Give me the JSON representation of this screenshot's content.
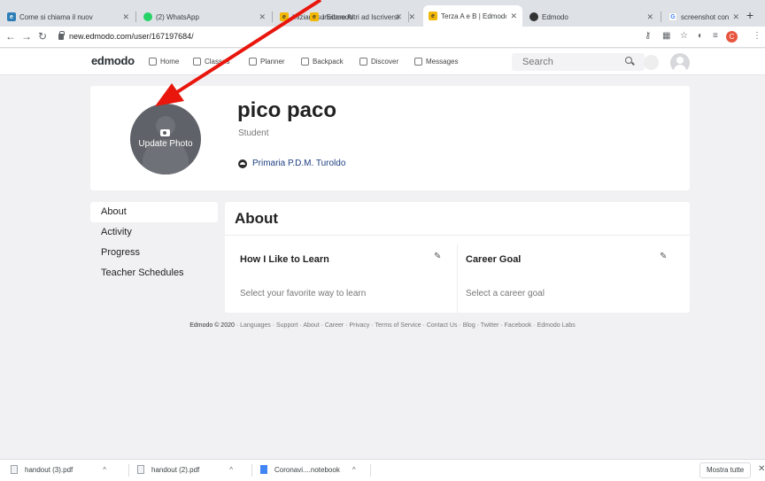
{
  "browser": {
    "tabs": [
      {
        "title": "Come si chiama il nuov",
        "fav_color": "#2e7fb8",
        "fav_icon": "edmodo-icon"
      },
      {
        "title": "(2) WhatsApp",
        "fav_color": "#25d366",
        "fav_icon": "whatsapp-icon"
      },
      {
        "title": "Iniziare su Edmodo",
        "fav_color": "#f2b705",
        "fav_icon": "edmodo-icon"
      },
      {
        "title": "Invitare Altri ad Iscriversi",
        "fav_color": "#f2b705",
        "fav_icon": "edmodo-icon"
      },
      {
        "title": "Terza A e B | Edmodo",
        "fav_color": "#f2b705",
        "fav_icon": "edmodo-icon"
      },
      {
        "title": "Edmodo",
        "fav_color": "#333333",
        "fav_icon": "edmodo-circle-icon"
      },
      {
        "title": "screenshot con mac",
        "fav_color": "#4285f4",
        "fav_icon": "google-icon"
      }
    ],
    "url": "new.edmodo.com/user/167197684/",
    "profile_initial": "C"
  },
  "nav": {
    "logo": "edmodo",
    "items": [
      "Home",
      "Classes",
      "Planner",
      "Backpack",
      "Discover",
      "Messages"
    ],
    "search_placeholder": "Search"
  },
  "profile": {
    "name": "pico paco",
    "role": "Student",
    "school": "Primaria P.D.M. Turoldo",
    "photo_label": "Update Photo"
  },
  "side_menu": [
    "About",
    "Activity",
    "Progress",
    "Teacher Schedules"
  ],
  "about": {
    "title": "About",
    "learn_title": "How I Like to Learn",
    "learn_placeholder": "Select your favorite way to learn",
    "goal_title": "Career Goal",
    "goal_placeholder": "Select a career goal"
  },
  "footer": {
    "brand": "Edmodo © 2020",
    "links": "Languages · Support · About · Career · Privacy · Terms of Service · Contact Us · Blog · Twitter · Facebook · Edmodo Labs"
  },
  "downloads": {
    "items": [
      "handout (3).pdf",
      "handout (2).pdf",
      "Coronavi....notebook"
    ],
    "show_all": "Mostra tutte"
  },
  "colors": {
    "annotation_arrow": "#e8160c",
    "link": "#1d3f80"
  }
}
